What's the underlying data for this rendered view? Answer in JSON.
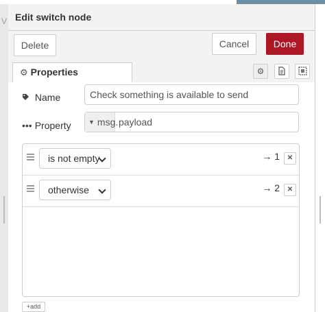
{
  "tray": {
    "title": "Edit switch node",
    "delete_label": "Delete",
    "cancel_label": "Cancel",
    "done_label": "Done"
  },
  "tabs": {
    "properties_label": "Properties",
    "icons": [
      "gear-icon",
      "document-icon",
      "appearance-icon"
    ]
  },
  "form": {
    "name_label": "Name",
    "name_value": "Check something is available to send",
    "property_label": "Property",
    "property_type": "msg.",
    "property_value": "payload"
  },
  "rules": [
    {
      "operator": "is not empty",
      "output": "→ 1"
    },
    {
      "operator": "otherwise",
      "output": "→ 2"
    }
  ],
  "add_label": "add",
  "colors": {
    "done": "#ad1625",
    "border": "#cccccc",
    "background": "#f3f3f3"
  }
}
